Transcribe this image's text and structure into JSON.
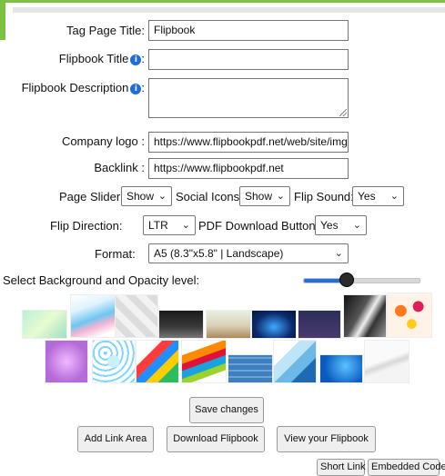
{
  "form": {
    "tag_page_title_label": "Tag Page Title:",
    "tag_page_title_value": "Flipbook",
    "flipbook_title_label": "Flipbook Title",
    "flipbook_desc_label": "Flipbook Description",
    "colon": ":",
    "company_logo_label": "Company logo :",
    "company_logo_value": "https://www.flipbookpdf.net/web/site/img/log",
    "backlink_label": "Backlink :",
    "backlink_value": "https://www.flipbookpdf.net",
    "info_glyph": "i"
  },
  "options": {
    "page_slider_label": "Page Slider:",
    "page_slider_value": "Show",
    "social_icons_label": "Social Icons:",
    "social_icons_value": "Show",
    "flip_sound_label": "Flip Sound:",
    "flip_sound_value": "Yes",
    "flip_direction_label": "Flip Direction:",
    "flip_direction_value": "LTR",
    "pdf_download_label": "PDF Download Button:",
    "pdf_download_value": "Yes",
    "format_label": "Format:",
    "format_value": "A5 (8.3\"x5.8\" | Landscape)",
    "chevron": "⌄"
  },
  "background": {
    "label": "Select Background and Opacity level:",
    "opacity_level": 0.35
  },
  "buttons": {
    "save": "Save changes",
    "add_link": "Add Link Area",
    "download": "Download Flipbook",
    "view": "View your Flipbook",
    "short_link": "Short Link",
    "embedded_code": "Embedded Code"
  },
  "colors": {
    "accent_green": "#7cc242",
    "slider_blue": "#1f6fe0",
    "info_blue": "#1e6fd9"
  }
}
